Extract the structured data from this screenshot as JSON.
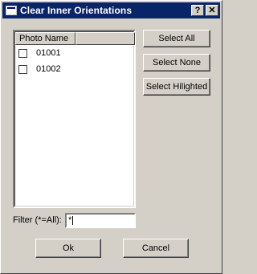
{
  "window": {
    "title": "Clear Inner Orientations",
    "help_label": "?",
    "close_label": "✕"
  },
  "list": {
    "columns": [
      "Photo Name",
      ""
    ],
    "rows": [
      {
        "name": "01001",
        "checked": false
      },
      {
        "name": "01002",
        "checked": false
      }
    ]
  },
  "buttons": {
    "select_all": "Select All",
    "select_none": "Select None",
    "select_hilighted": "Select Hilighted",
    "ok": "Ok",
    "cancel": "Cancel"
  },
  "filter": {
    "label": "Filter (*=All):",
    "value": "*"
  }
}
